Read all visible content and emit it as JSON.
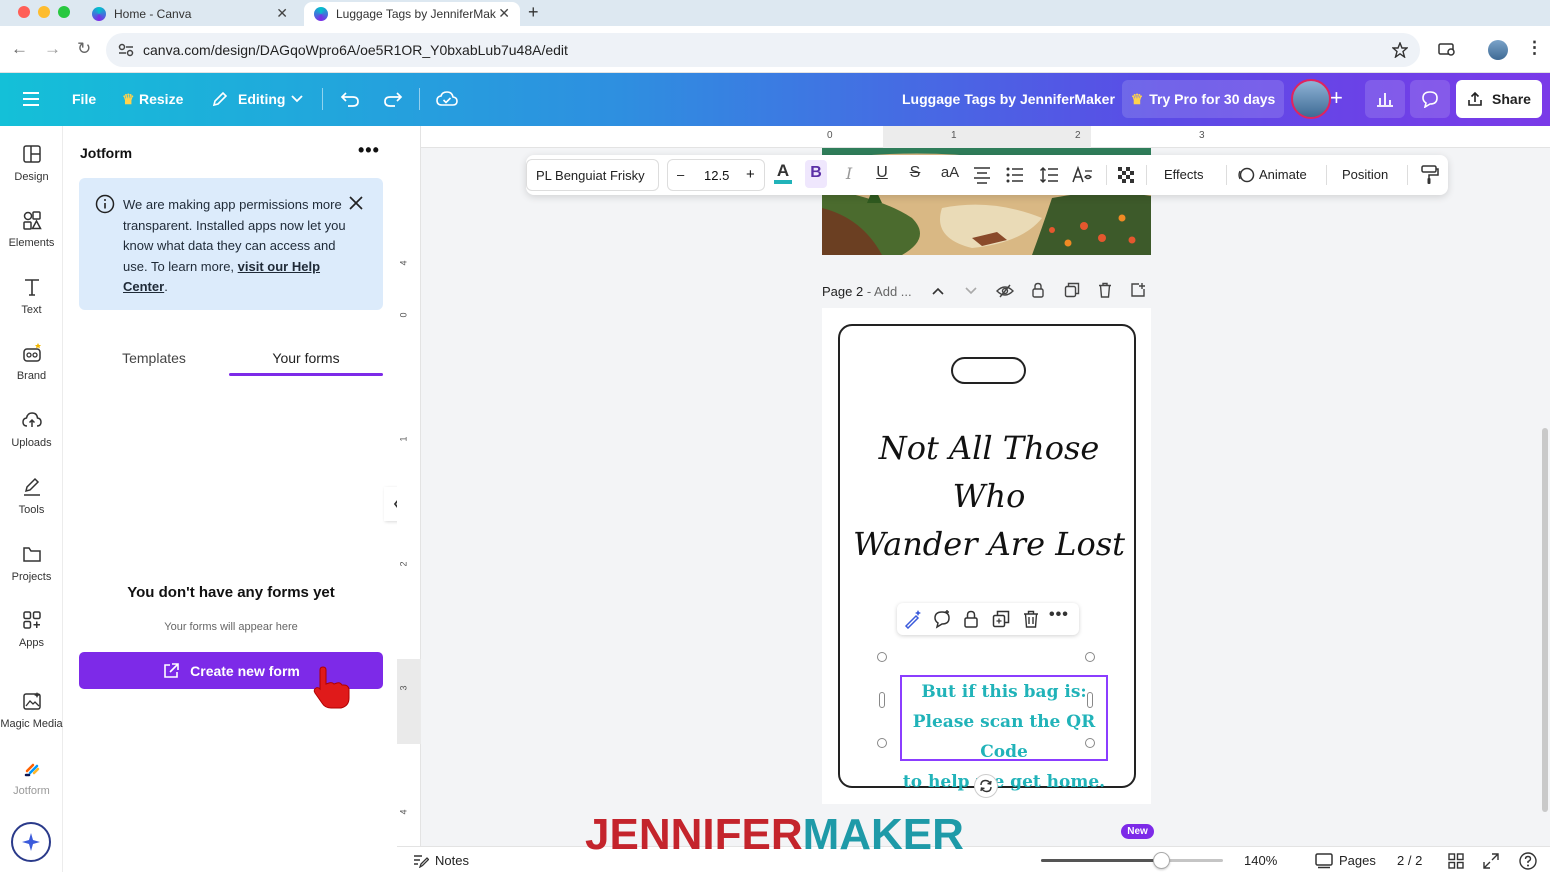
{
  "browser": {
    "tabs": [
      {
        "label": "Home - Canva",
        "active": false
      },
      {
        "label": "Luggage Tags by JenniferMak",
        "active": true
      }
    ],
    "url": "canva.com/design/DAGqoWpro6A/oe5R1OR_Y0bxabLub7u48A/edit"
  },
  "topbar": {
    "file": "File",
    "resize": "Resize",
    "editing": "Editing",
    "design_title": "Luggage Tags by JenniferMaker",
    "try_pro": "Try Pro for 30 days",
    "share": "Share",
    "gradient_start": "#14c0d8",
    "gradient_end": "#7a3ae8"
  },
  "rail": {
    "items": [
      {
        "label": "Design",
        "icon": "layout-icon"
      },
      {
        "label": "Elements",
        "icon": "shapes-icon"
      },
      {
        "label": "Text",
        "icon": "text-icon"
      },
      {
        "label": "Brand",
        "icon": "brand-icon"
      },
      {
        "label": "Uploads",
        "icon": "upload-cloud-icon"
      },
      {
        "label": "Tools",
        "icon": "pen-icon"
      },
      {
        "label": "Projects",
        "icon": "folder-icon"
      },
      {
        "label": "Apps",
        "icon": "apps-grid-icon"
      },
      {
        "label": "Magic Media",
        "icon": "magic-media-icon"
      },
      {
        "label": "Jotform",
        "icon": "jotform-icon"
      }
    ]
  },
  "panel": {
    "title": "Jotform",
    "notice_text": "We are making app permissions more transparent. Installed apps now let you know what data they can access and use. To learn more, ",
    "notice_link": "visit our Help Center",
    "notice_period": ".",
    "tabs": [
      {
        "label": "Templates",
        "active": false
      },
      {
        "label": "Your forms",
        "active": true
      }
    ],
    "empty_title": "You don't have any forms yet",
    "empty_sub": "Your forms will appear here",
    "create_button": "Create new form",
    "accent": "#7d2ae8"
  },
  "text_toolbar": {
    "font": "PL Benguiat Frisky",
    "font_size": "12.5",
    "minus": "–",
    "plus": "+",
    "effects": "Effects",
    "animate": "Animate",
    "position": "Position",
    "text_color": "#21b3b9"
  },
  "rulers": {
    "top": [
      "0",
      "1",
      "2",
      "3"
    ],
    "left": [
      "4",
      "0",
      "1",
      "2",
      "3",
      "4"
    ]
  },
  "page2": {
    "label": "Page 2",
    "add_title": " - Add ...",
    "tag_title_line1": "Not All Those Who",
    "tag_title_line2": "Wander Are Lost",
    "tag_text_line1": "But if this bag is:",
    "tag_text_line2": "Please scan the QR Code",
    "tag_text_line3": "to help me get home."
  },
  "bottombar": {
    "notes": "Notes",
    "zoom": "140%",
    "zoom_fraction": 0.66,
    "pages": "Pages",
    "page_count": "2 / 2",
    "new_badge": "New"
  },
  "watermark": {
    "part1": "JENNIFER",
    "part2": "MAKER"
  }
}
